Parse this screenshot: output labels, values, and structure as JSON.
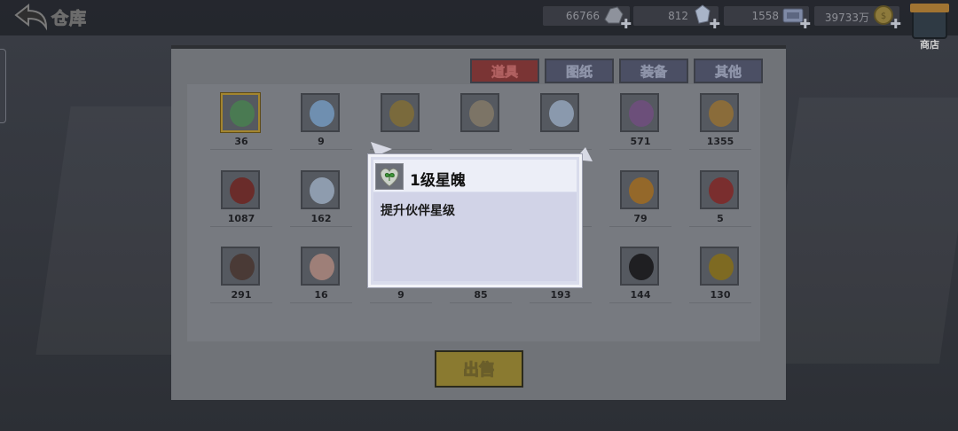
{
  "header": {
    "title": "仓库",
    "back_icon": "back-arrow-icon",
    "resources": [
      {
        "value": "66766",
        "icon": "silver-ore-icon"
      },
      {
        "value": "812",
        "icon": "crystal-icon"
      },
      {
        "value": "1558",
        "icon": "ticket-icon"
      },
      {
        "value": "39733万",
        "icon": "gold-coin-icon"
      }
    ],
    "shop_label": "商店"
  },
  "tabs": [
    {
      "label": "道具",
      "active": true
    },
    {
      "label": "图纸",
      "active": false
    },
    {
      "label": "装备",
      "active": false
    },
    {
      "label": "其他",
      "active": false
    }
  ],
  "items": [
    {
      "count": "36",
      "icon": "heart-clover-icon"
    },
    {
      "count": "9",
      "icon": "blue-crystal-icon"
    },
    {
      "count": "",
      "icon": "key-icon"
    },
    {
      "count": "",
      "icon": "wrench-icon"
    },
    {
      "count": "",
      "icon": "bone-icon"
    },
    {
      "count": "571",
      "icon": "purple-shirt-icon"
    },
    {
      "count": "1355",
      "icon": "lightning-icon"
    },
    {
      "count": "1087",
      "icon": "red-ring-icon"
    },
    {
      "count": "162",
      "icon": "water-drop-icon"
    },
    {
      "count": "",
      "icon": "hidden-item-icon"
    },
    {
      "count": "",
      "icon": "hidden-item-icon"
    },
    {
      "count": "",
      "icon": "hidden-item-icon"
    },
    {
      "count": "79",
      "icon": "orange-orb-icon"
    },
    {
      "count": "5",
      "icon": "red-orb-icon"
    },
    {
      "count": "291",
      "icon": "dark-egg-icon"
    },
    {
      "count": "16",
      "icon": "pink-egg-icon"
    },
    {
      "count": "9",
      "icon": "red-egg-icon"
    },
    {
      "count": "85",
      "icon": "green-egg-icon"
    },
    {
      "count": "193",
      "icon": "purple-egg-icon"
    },
    {
      "count": "144",
      "icon": "black-egg-icon"
    },
    {
      "count": "130",
      "icon": "yellow-egg-icon"
    }
  ],
  "sell_label": "出售",
  "popup": {
    "title": "1级星魄",
    "description": "提升伙伴星级",
    "icon": "heart-clover-icon"
  }
}
